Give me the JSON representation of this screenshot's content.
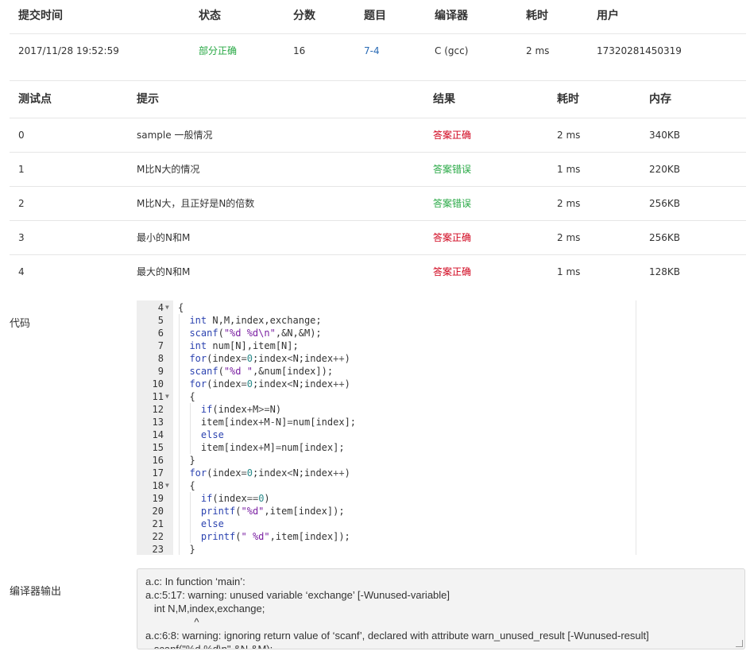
{
  "submission": {
    "headers": [
      "提交时间",
      "状态",
      "分数",
      "题目",
      "编译器",
      "耗时",
      "用户"
    ],
    "time": "2017/11/28 19:52:59",
    "status": "部分正确",
    "score": "16",
    "problem": "7-4",
    "compiler": "C (gcc)",
    "duration": "2 ms",
    "user": "17320281450319"
  },
  "tests": {
    "headers": [
      "测试点",
      "提示",
      "结果",
      "耗时",
      "内存"
    ],
    "rows": [
      {
        "id": "0",
        "hint": "sample 一般情况",
        "result": "答案正确",
        "time": "2 ms",
        "memory": "340KB"
      },
      {
        "id": "1",
        "hint": "M比N大的情况",
        "result": "答案错误",
        "time": "1 ms",
        "memory": "220KB"
      },
      {
        "id": "2",
        "hint": "M比N大，且正好是N的倍数",
        "result": "答案错误",
        "time": "2 ms",
        "memory": "256KB"
      },
      {
        "id": "3",
        "hint": "最小的N和M",
        "result": "答案正确",
        "time": "2 ms",
        "memory": "256KB"
      },
      {
        "id": "4",
        "hint": "最大的N和M",
        "result": "答案正确",
        "time": "1 ms",
        "memory": "128KB"
      }
    ]
  },
  "labels": {
    "code": "代码",
    "compiler_output": "编译器输出"
  },
  "code_lines": [
    {
      "n": "4",
      "fold": true,
      "text": "{"
    },
    {
      "n": "5",
      "text": "  int N,M,index,exchange;"
    },
    {
      "n": "6",
      "text": "  scanf(\"%d %d\\n\",&N,&M);"
    },
    {
      "n": "7",
      "text": "  int num[N],item[N];"
    },
    {
      "n": "8",
      "text": "  for(index=0;index<N;index++)"
    },
    {
      "n": "9",
      "text": "  scanf(\"%d \",&num[index]);"
    },
    {
      "n": "10",
      "text": "  for(index=0;index<N;index++)"
    },
    {
      "n": "11",
      "fold": true,
      "text": "  {"
    },
    {
      "n": "12",
      "text": "    if(index+M>=N)"
    },
    {
      "n": "13",
      "text": "    item[index+M-N]=num[index];"
    },
    {
      "n": "14",
      "text": "    else"
    },
    {
      "n": "15",
      "text": "    item[index+M]=num[index];"
    },
    {
      "n": "16",
      "text": "  }"
    },
    {
      "n": "17",
      "text": "  for(index=0;index<N;index++)"
    },
    {
      "n": "18",
      "fold": true,
      "text": "  {"
    },
    {
      "n": "19",
      "text": "    if(index==0)"
    },
    {
      "n": "20",
      "text": "    printf(\"%d\",item[index]);"
    },
    {
      "n": "21",
      "text": "    else"
    },
    {
      "n": "22",
      "text": "    printf(\" %d\",item[index]);"
    },
    {
      "n": "23",
      "text": "  }"
    }
  ],
  "compiler_output": [
    "a.c: In function ‘main’:",
    "a.c:5:17: warning: unused variable ‘exchange’ [-Wunused-variable]",
    "   int N,M,index,exchange;",
    "                 ^",
    "a.c:6:8: warning: ignoring return value of ‘scanf’, declared with attribute warn_unused_result [-Wunused-result]",
    "   scanf(\"%d %d\\n\",&N,&M);"
  ],
  "colors": {
    "green": "#27a844",
    "red": "#d0021b",
    "blue": "#2a6bb5"
  }
}
